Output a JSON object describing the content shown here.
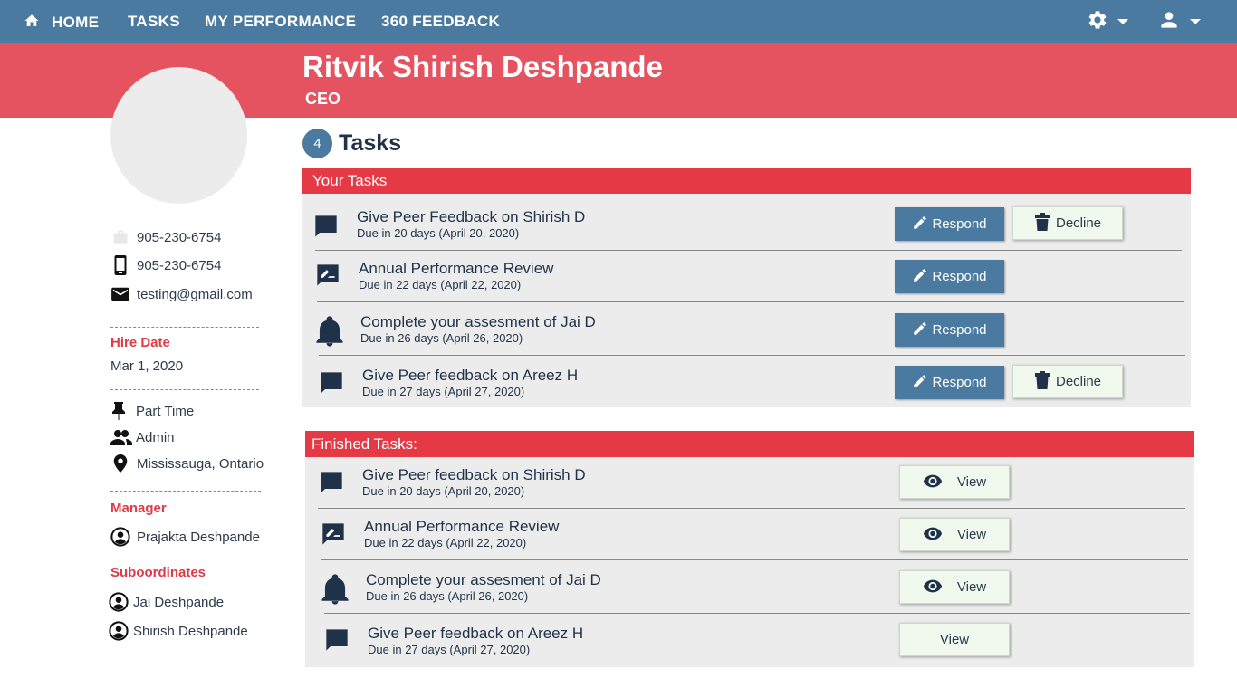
{
  "nav": {
    "home": "HOME",
    "tasks": "TASKS",
    "performance": "MY PERFORMANCE",
    "feedback": "360 FEEDBACK"
  },
  "profile": {
    "name": "Ritvik Shirish Deshpande",
    "title": "CEO",
    "phone_work": "905-230-6754",
    "phone_mobile": "905-230-6754",
    "email": "testing@gmail.com",
    "hire_date_label": "Hire Date",
    "hire_date": "Mar 1, 2020",
    "employment": "Part Time",
    "role": "Admin",
    "location": "Mississauga, Ontario",
    "manager_label": "Manager",
    "manager": "Prajakta Deshpande",
    "subordinates_label": "Suboordinates",
    "subordinates": [
      "Jai Deshpande",
      "Shirish Deshpande"
    ]
  },
  "tasks": {
    "count": "4",
    "heading": "Tasks",
    "your_tasks_label": "Your Tasks",
    "finished_label": "Finished Tasks:",
    "respond_label": "Respond",
    "decline_label": "Decline",
    "view_label": "View",
    "active": [
      {
        "icon": "chat-icon",
        "title": "Give Peer Feedback on Shirish D",
        "due": "Due in 20 days (April 20, 2020)"
      },
      {
        "icon": "rate-review-icon",
        "title": "Annual Performance Review",
        "due": "Due in 22 days (April 22, 2020)"
      },
      {
        "icon": "bell-icon",
        "title": "Complete your assesment of Jai D",
        "due": "Due in 26 days (April 26, 2020)"
      },
      {
        "icon": "chat-icon",
        "title": "Give Peer feedback on Areez H",
        "due": "Due in 27 days (April 27, 2020)"
      }
    ],
    "finished": [
      {
        "icon": "chat-icon",
        "title": "Give Peer feedback on Shirish D",
        "due": "Due in 20 days (April 20, 2020)"
      },
      {
        "icon": "rate-review-icon",
        "title": "Annual Performance Review",
        "due": "Due in 22 days (April 22, 2020)"
      },
      {
        "icon": "bell-icon",
        "title": "Complete your assesment of Jai D",
        "due": "Due in 26 days (April 26, 2020)"
      },
      {
        "icon": "chat-icon",
        "title": "Give Peer feedback on Areez H",
        "due": "Due in 27 days (April 27, 2020)"
      }
    ]
  },
  "colors": {
    "nav": "#4a7aa0",
    "banner": "#e55361",
    "panel_header": "#e63946",
    "accent_label": "#e03a48",
    "respond_button": "#4a7aa0",
    "light_button": "#f1f8ee"
  }
}
